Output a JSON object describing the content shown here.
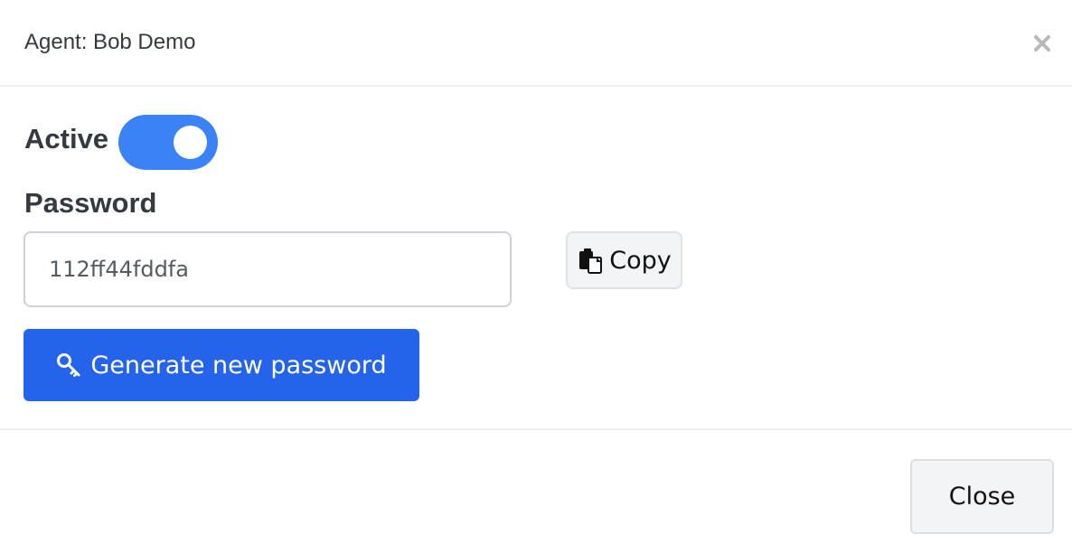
{
  "header": {
    "title": "Agent: Bob Demo",
    "close_icon": "close-icon"
  },
  "form": {
    "active": {
      "label": "Active",
      "enabled": true,
      "color": "#3b82f6"
    },
    "password": {
      "label": "Password",
      "value": "112ff44fddfa"
    },
    "copy_button": {
      "label": "Copy",
      "icon": "clipboard-icon"
    },
    "generate_button": {
      "label": "Generate new password",
      "icon": "key-icon",
      "color": "#2563eb"
    }
  },
  "footer": {
    "close_label": "Close"
  }
}
